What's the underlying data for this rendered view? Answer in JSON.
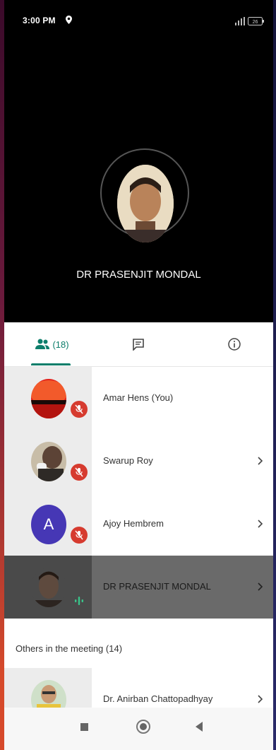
{
  "status_bar": {
    "time": "3:00 PM",
    "battery": "26"
  },
  "speaker": {
    "name": "DR PRASENJIT MONDAL"
  },
  "tabs": {
    "people_count": "(18)"
  },
  "participants": [
    {
      "name": "Amar Hens (You)",
      "muted": true,
      "initial": ""
    },
    {
      "name": "Swarup Roy",
      "muted": true,
      "initial": ""
    },
    {
      "name": "Ajoy Hembrem",
      "muted": true,
      "initial": "A"
    },
    {
      "name": "DR PRASENJIT MONDAL",
      "muted": false,
      "initial": ""
    }
  ],
  "others": {
    "label": "Others in the meeting (14)",
    "first_name": "Dr. Anirban Chattopadhyay"
  },
  "colors": {
    "accent": "#0d7e6b",
    "mute": "#d63b2f",
    "letter_avatar": "#4637b5"
  }
}
